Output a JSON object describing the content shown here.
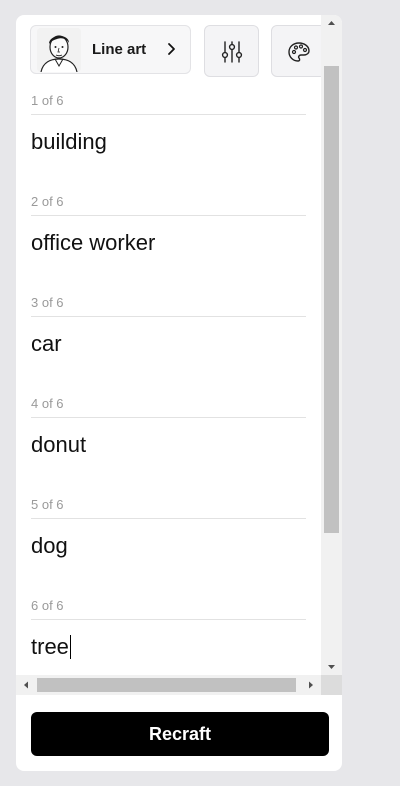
{
  "toolbar": {
    "style_label": "Line art",
    "style_thumb_icon": "line-art-portrait-icon",
    "chevron_icon": "chevron-right-icon",
    "adjustments_icon": "sliders-icon",
    "palette_icon": "palette-icon"
  },
  "prompts": [
    {
      "counter": "1 of 6",
      "value": "building"
    },
    {
      "counter": "2 of 6",
      "value": "office worker"
    },
    {
      "counter": "3 of 6",
      "value": "car"
    },
    {
      "counter": "4 of 6",
      "value": "donut"
    },
    {
      "counter": "5 of 6",
      "value": "dog"
    },
    {
      "counter": "6 of 6",
      "value": "tree"
    }
  ],
  "scrollbars": {
    "vertical_thumb_start_fraction": 0.08,
    "vertical_thumb_size_fraction": 0.75,
    "horizontal_thumb_start_fraction": 0.08,
    "horizontal_thumb_size_fraction": 0.97
  },
  "actions": {
    "recraft_label": "Recraft"
  },
  "colors": {
    "page_background": "#e7e7ea",
    "panel_background": "#ffffff",
    "primary_button": "#000000",
    "primary_button_text": "#ffffff",
    "counter_text": "#9a9a9a"
  }
}
